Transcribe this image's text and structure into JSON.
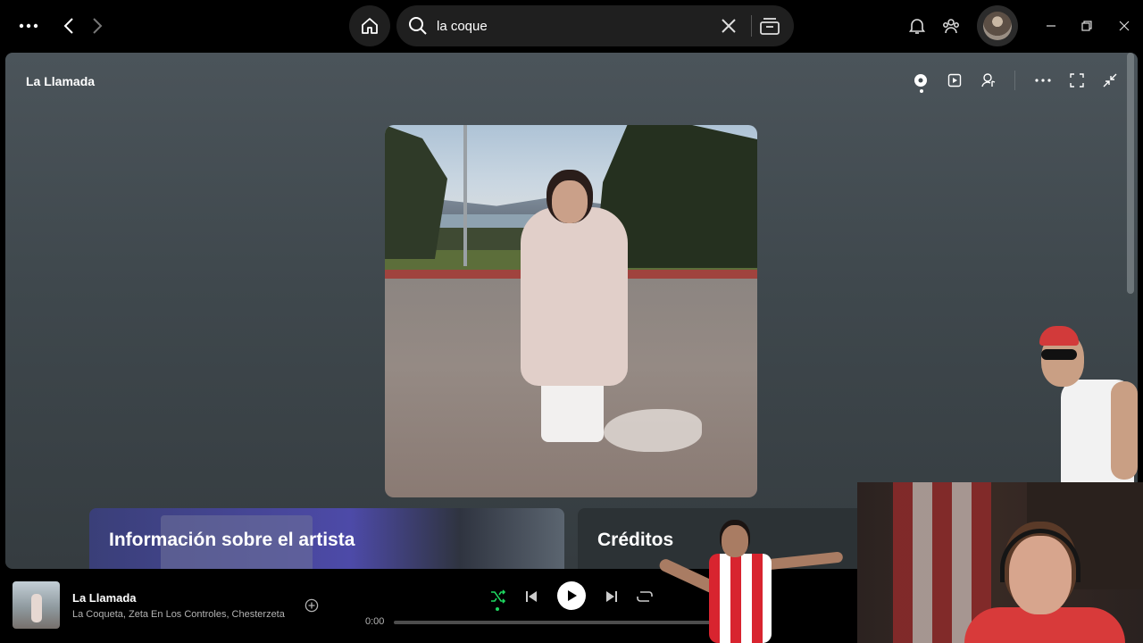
{
  "topbar": {
    "menu_icon": "more-horizontal-icon",
    "back_icon": "chevron-left-icon",
    "forward_icon": "chevron-right-icon",
    "home_icon": "home-icon",
    "search": {
      "value": "la coque",
      "placeholder": "",
      "clear_icon": "close-icon",
      "browse_icon": "browse-icon"
    },
    "notifications_icon": "bell-icon",
    "friends_icon": "friends-activity-icon",
    "window_controls": [
      "minimize-icon",
      "restore-icon",
      "close-icon"
    ]
  },
  "now_playing_view": {
    "title": "La Llamada",
    "header_icons": [
      "now-playing-icon",
      "video-icon",
      "lyrics-icon",
      "more-horizontal-icon",
      "fullscreen-icon",
      "collapse-icon"
    ],
    "cards": [
      {
        "title": "Información sobre el artista"
      },
      {
        "title": "Créditos"
      }
    ]
  },
  "player": {
    "track_title": "La Llamada",
    "artists": "La Coqueta, Zeta En Los Controles, Chesterzeta",
    "current_time": "0:00",
    "progress": 0,
    "shuffle_active": true,
    "accent_color": "#1ed760",
    "controls": [
      "shuffle-icon",
      "previous-icon",
      "play-icon",
      "next-icon",
      "repeat-icon"
    ]
  }
}
